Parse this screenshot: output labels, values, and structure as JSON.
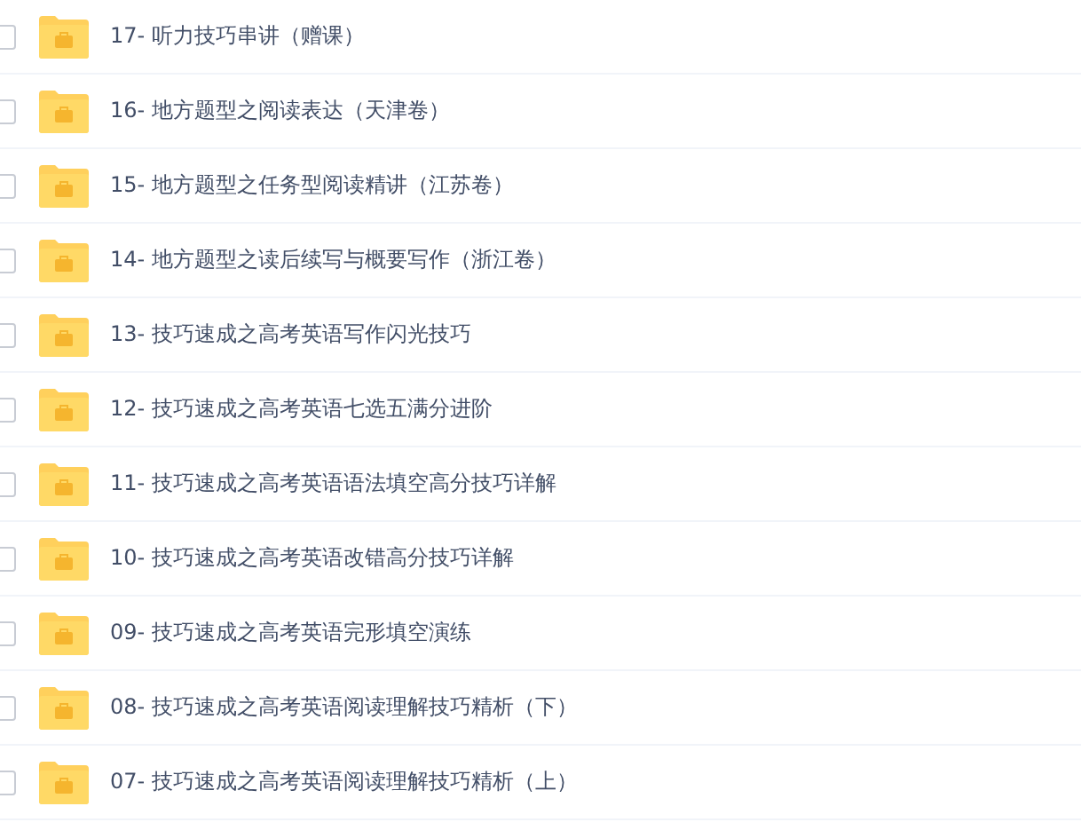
{
  "files": [
    {
      "name": "17- 听力技巧串讲（赠课）",
      "checked": false
    },
    {
      "name": "16- 地方题型之阅读表达（天津卷）",
      "checked": false
    },
    {
      "name": "15- 地方题型之任务型阅读精讲（江苏卷）",
      "checked": false
    },
    {
      "name": "14- 地方题型之读后续写与概要写作（浙江卷）",
      "checked": false
    },
    {
      "name": "13- 技巧速成之高考英语写作闪光技巧",
      "checked": false
    },
    {
      "name": "12- 技巧速成之高考英语七选五满分进阶",
      "checked": false
    },
    {
      "name": "11- 技巧速成之高考英语语法填空高分技巧详解",
      "checked": false
    },
    {
      "name": "10- 技巧速成之高考英语改错高分技巧详解",
      "checked": false
    },
    {
      "name": "09- 技巧速成之高考英语完形填空演练",
      "checked": false
    },
    {
      "name": "08- 技巧速成之高考英语阅读理解技巧精析（下）",
      "checked": false
    },
    {
      "name": "07- 技巧速成之高考英语阅读理解技巧精析（上）",
      "checked": false
    }
  ]
}
